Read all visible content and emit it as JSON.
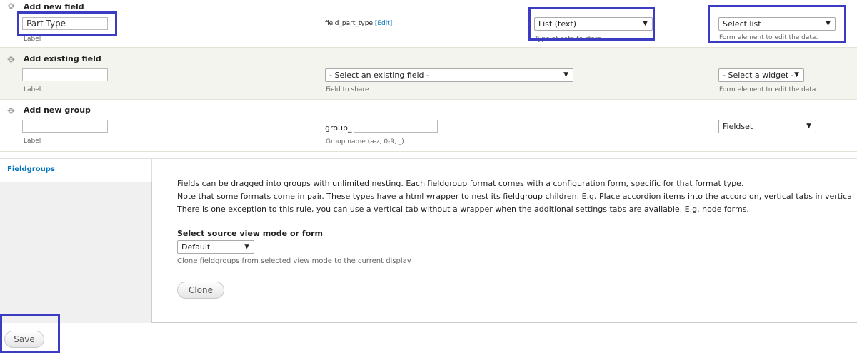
{
  "add_new_field": {
    "title": "Add new field",
    "label_value": "Part Type",
    "label_desc": "Label",
    "machine_name": "field_part_type",
    "edit_link": "[Edit]",
    "type_value": "List (text)",
    "type_desc": "Type of data to store.",
    "widget_value": "Select list",
    "widget_desc": "Form element to edit the data."
  },
  "add_existing_field": {
    "title": "Add existing field",
    "label_desc": "Label",
    "field_select": "- Select an existing field -",
    "field_desc": "Field to share",
    "widget_select": "- Select a widget -",
    "widget_desc": "Form element to edit the data."
  },
  "add_new_group": {
    "title": "Add new group",
    "label_desc": "Label",
    "prefix": "group_",
    "name_desc": "Group name (a-z, 0-9, _)",
    "format_select": "Fieldset"
  },
  "fieldgroups": {
    "tab_label": "Fieldgroups",
    "paragraphs": [
      "Fields can be dragged into groups with unlimited nesting. Each fieldgroup format comes with a configuration form, specific for that format type.",
      "Note that some formats come in pair. These types have a html wrapper to nest its fieldgroup children. E.g. Place accordion items into the accordion, vertical tabs in vertical",
      "There is one exception to this rule, you can use a vertical tab without a wrapper when the additional settings tabs are available. E.g. node forms."
    ],
    "source_label": "Select source view mode or form",
    "source_value": "Default",
    "source_desc": "Clone fieldgroups from selected view mode to the current display",
    "clone_button": "Clone"
  },
  "save_button": "Save",
  "colors": {
    "highlight": "#3b3bc4",
    "link": "#0074bd",
    "row_alt": "#f3f4ee"
  },
  "icons": {
    "drag": "drag-handle-icon",
    "dropdown": "dropdown-arrow-icon"
  }
}
